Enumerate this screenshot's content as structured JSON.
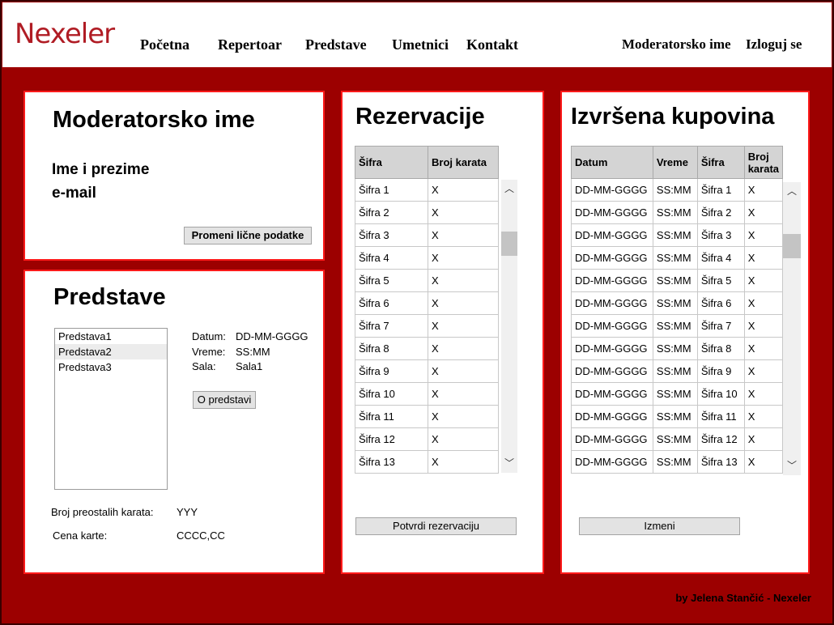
{
  "brand": "Nexeler",
  "nav": [
    "Početna",
    "Repertoar",
    "Predstave",
    "Umetnici",
    "Kontakt"
  ],
  "user": {
    "name": "Moderatorsko ime",
    "logout": "Izloguj se"
  },
  "profile": {
    "title": "Moderatorsko ime",
    "full_name": "Ime i prezime",
    "email": "e-mail",
    "edit_button": "Promeni lične podatke"
  },
  "shows": {
    "title": "Predstave",
    "list": [
      "Predstava1",
      "Predstava2",
      "Predstava3"
    ],
    "selected_index": 1,
    "details": {
      "date_label": "Datum:",
      "date_value": "DD-MM-GGGG",
      "time_label": "Vreme:",
      "time_value": "SS:MM",
      "hall_label": "Sala:",
      "hall_value": "Sala1"
    },
    "about_button": "O predstavi",
    "remaining_label": "Broj preostalih karata:",
    "remaining_value": "YYY",
    "price_label": "Cena karte:",
    "price_value": "CCCC,CC"
  },
  "reservations": {
    "title": "Rezervacije",
    "columns": [
      "Šifra",
      "Broj karata"
    ],
    "rows": [
      [
        "Šifra 1",
        "X"
      ],
      [
        "Šifra 2",
        "X"
      ],
      [
        "Šifra 3",
        "X"
      ],
      [
        "Šifra 4",
        "X"
      ],
      [
        "Šifra 5",
        "X"
      ],
      [
        "Šifra 6",
        "X"
      ],
      [
        "Šifra 7",
        "X"
      ],
      [
        "Šifra 8",
        "X"
      ],
      [
        "Šifra 9",
        "X"
      ],
      [
        "Šifra 10",
        "X"
      ],
      [
        "Šifra 11",
        "X"
      ],
      [
        "Šifra 12",
        "X"
      ],
      [
        "Šifra 13",
        "X"
      ]
    ],
    "confirm_button": "Potvrdi rezervaciju"
  },
  "purchases": {
    "title": "Izvršena kupovina",
    "columns": [
      "Datum",
      "Vreme",
      "Šifra",
      "Broj karata"
    ],
    "rows": [
      [
        "DD-MM-GGGG",
        "SS:MM",
        "Šifra 1",
        "X"
      ],
      [
        "DD-MM-GGGG",
        "SS:MM",
        "Šifra 2",
        "X"
      ],
      [
        "DD-MM-GGGG",
        "SS:MM",
        "Šifra 3",
        "X"
      ],
      [
        "DD-MM-GGGG",
        "SS:MM",
        "Šifra 4",
        "X"
      ],
      [
        "DD-MM-GGGG",
        "SS:MM",
        "Šifra 5",
        "X"
      ],
      [
        "DD-MM-GGGG",
        "SS:MM",
        "Šifra 6",
        "X"
      ],
      [
        "DD-MM-GGGG",
        "SS:MM",
        "Šifra 7",
        "X"
      ],
      [
        "DD-MM-GGGG",
        "SS:MM",
        "Šifra 8",
        "X"
      ],
      [
        "DD-MM-GGGG",
        "SS:MM",
        "Šifra 9",
        "X"
      ],
      [
        "DD-MM-GGGG",
        "SS:MM",
        "Šifra 10",
        "X"
      ],
      [
        "DD-MM-GGGG",
        "SS:MM",
        "Šifra 11",
        "X"
      ],
      [
        "DD-MM-GGGG",
        "SS:MM",
        "Šifra 12",
        "X"
      ],
      [
        "DD-MM-GGGG",
        "SS:MM",
        "Šifra 13",
        "X"
      ]
    ],
    "edit_button": "Izmeni"
  },
  "footer": "by Jelena Stančić - Nexeler",
  "colors": {
    "background": "#9c0000",
    "panel_border": "#ff1a1a",
    "brand": "#b01c24"
  }
}
